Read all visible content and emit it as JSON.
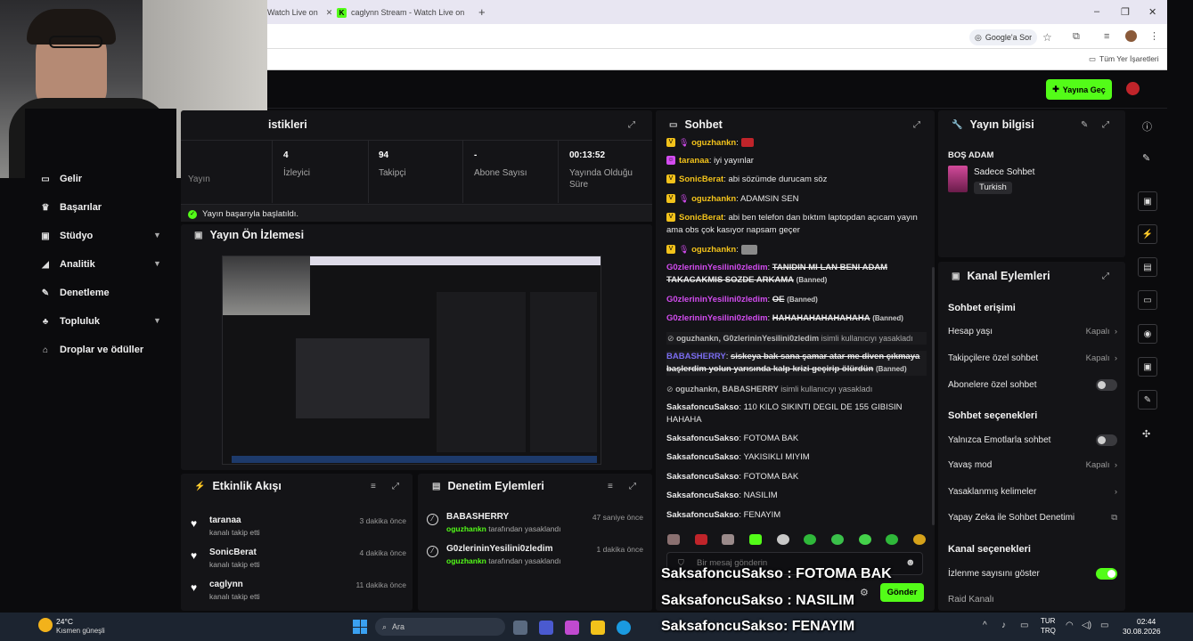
{
  "browser": {
    "tabs": [
      {
        "title": "Watch Live on"
      },
      {
        "title": "caglynn Stream - Watch Live on"
      }
    ],
    "new_tab": "+",
    "window_controls": {
      "minimize": "–",
      "restore": "❐",
      "close": "✕"
    },
    "address_actions": {
      "google_lens_label": "Google'a Sor"
    },
    "bookmarks_all": "Tüm Yer İşaretleri"
  },
  "header": {
    "go_live_label": "Yayına Geç"
  },
  "sidebar": {
    "items": [
      {
        "label": "Gelir",
        "icon": "money-icon"
      },
      {
        "label": "Başarılar",
        "icon": "trophy-icon"
      },
      {
        "label": "Stüdyo",
        "icon": "studio-icon",
        "expandable": true
      },
      {
        "label": "Analitik",
        "icon": "analytics-icon",
        "expandable": true
      },
      {
        "label": "Denetleme",
        "icon": "wrench-icon"
      },
      {
        "label": "Topluluk",
        "icon": "community-icon",
        "expandable": true
      },
      {
        "label": "Droplar ve ödüller",
        "icon": "gift-icon"
      }
    ]
  },
  "stats_panel": {
    "title": "istikleri",
    "partial_label": "Yayın",
    "stats": [
      {
        "value": "4",
        "label": "İzleyici"
      },
      {
        "value": "94",
        "label": "Takipçi"
      },
      {
        "value": "-",
        "label": "Abone Sayısı"
      },
      {
        "value": "00:13:52",
        "label": "Yayında Olduğu Süre"
      }
    ],
    "status": "Yayın başarıyla başlatıldı."
  },
  "preview_panel": {
    "title": "Yayın Ön İzlemesi"
  },
  "activity_panel": {
    "title": "Etkinlik Akışı",
    "events": [
      {
        "name": "taranaa",
        "action": "kanalı takip etti",
        "time": "3 dakika önce"
      },
      {
        "name": "SonicBerat",
        "action": "kanalı takip etti",
        "time": "4 dakika önce"
      },
      {
        "name": "caglynn",
        "action": "kanalı takip etti",
        "time": "11 dakika önce"
      }
    ]
  },
  "moderation_panel": {
    "title": "Denetim Eylemleri",
    "actions": [
      {
        "name": "BABASHERRY",
        "by": "oguzhankn",
        "action": "tarafından yasaklandı",
        "time": "47 saniye önce"
      },
      {
        "name": "G0zlerininYesilini0zledim",
        "by": "oguzhankn",
        "action": "tarafından yasaklandı",
        "time": "1 dakika önce"
      }
    ]
  },
  "chat_panel": {
    "title": "Sohbet",
    "messages": [
      {
        "user": "oguzhankn",
        "text": "",
        "color": "#f2c21b"
      },
      {
        "user": "taranaa",
        "text": "iyi yayınlar",
        "color": "#f2c21b"
      },
      {
        "user": "SonicBerat",
        "text": "abi sözümde durucam söz",
        "color": "#f2c21b"
      },
      {
        "user": "oguzhankn",
        "text": "ADAMSIN SEN",
        "color": "#f2c21b"
      },
      {
        "user": "SonicBerat",
        "text": "abi ben telefon dan bıktım laptopdan açıcam yayın ama obs çok kasıyor napsam geçer",
        "color": "#f2c21b"
      },
      {
        "user": "oguzhankn",
        "text": "",
        "color": "#f2c21b"
      },
      {
        "user": "G0zlerininYesilini0zledim",
        "text": "TANIDIN MI LAN BENI ADAM TAKACAKMIS SOZDE ARKAMA",
        "banned": "(Banned)",
        "color": "#d34cf0"
      },
      {
        "user": "G0zlerininYesilini0zledim",
        "text": "OE",
        "banned": "(Banned)",
        "color": "#d34cf0"
      },
      {
        "user": "G0zlerininYesilini0zledim",
        "text": "HAHAHAHAHAHAHAHA",
        "banned": "(Banned)",
        "color": "#d34cf0"
      },
      {
        "system": "oguzhankn, G0zlerininYesilini0zledim",
        "system_text": "isimli kullanıcıyı yasakladı"
      },
      {
        "user": "BABASHERRY",
        "text": "siskeya bak sana şamar atar me diven çıkmaya başlerdim yolun yarısında kalp krizi geçirip ölürdün",
        "banned": "(Banned)",
        "color": "#7a6cf0"
      },
      {
        "system": "oguzhankn, BABASHERRY",
        "system_text": "isimli kullanıcıyı yasakladı"
      },
      {
        "user": "SaksafoncuSakso",
        "text": "110 KILO SIKINTI DEGIL DE 155 GIBISIN HAHAHA",
        "color": "#e8e8e8"
      },
      {
        "user": "SaksafoncuSakso",
        "text": "FOTOMA BAK",
        "color": "#e8e8e8"
      },
      {
        "user": "SaksafoncuSakso",
        "text": "YAKISIKLI MIYIM",
        "color": "#e8e8e8"
      },
      {
        "user": "SaksafoncuSakso",
        "text": "FOTOMA BAK",
        "color": "#e8e8e8"
      },
      {
        "user": "SaksafoncuSakso",
        "text": "NASILIM",
        "color": "#e8e8e8"
      },
      {
        "user": "SaksafoncuSakso",
        "text": "FENAYIM",
        "color": "#e8e8e8"
      }
    ],
    "input_placeholder": "Bir mesaj gönderin",
    "send_label": "Gönder"
  },
  "stream_info": {
    "title": "Yayın bilgisi",
    "stream_title": "BOŞ ADAM",
    "category": "Sadece Sohbet",
    "tag": "Turkish"
  },
  "channel_actions": {
    "title": "Kanal Eylemleri",
    "sections": {
      "chat_access": "Sohbet erişimi",
      "chat_options": "Sohbet seçenekleri",
      "channel_options": "Kanal seçenekleri"
    },
    "rows": {
      "account_age": {
        "label": "Hesap yaşı",
        "value": "Kapalı"
      },
      "followers_only": {
        "label": "Takipçilere özel sohbet",
        "value": "Kapalı"
      },
      "subscribers_only": {
        "label": "Abonelere özel sohbet"
      },
      "emote_only": {
        "label": "Yalnızca Emotlarla sohbet"
      },
      "slow_mode": {
        "label": "Yavaş mod",
        "value": "Kapalı"
      },
      "banned_words": {
        "label": "Yasaklanmış kelimeler"
      },
      "ai_moderation": {
        "label": "Yapay Zeka ile Sohbet Denetimi"
      },
      "show_viewers": {
        "label": "İzlenme sayısını göster"
      },
      "raid_channel": {
        "label": "Raid Kanalı"
      }
    }
  },
  "overlay": {
    "captions": [
      "SaksafoncuSakso : FOTOMA BAK",
      "SaksafoncuSakso : NASILIM",
      "SaksafoncuSakso: FENAYIM"
    ]
  },
  "taskbar": {
    "weather_temp": "24°C",
    "weather_desc": "Kısmen güneşli",
    "search_placeholder": "Ara",
    "lang_top": "TUR",
    "lang_bottom": "TRQ",
    "time": "02:44",
    "date": "30.08.2026"
  }
}
